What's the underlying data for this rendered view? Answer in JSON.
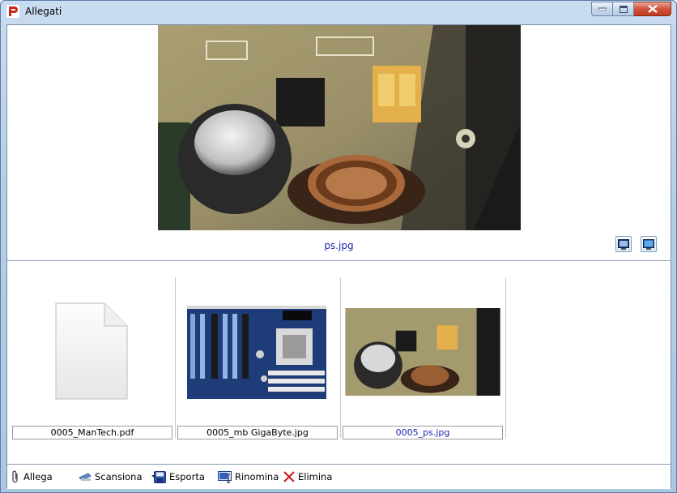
{
  "window": {
    "title": "Allegati"
  },
  "preview": {
    "filename": "ps.jpg"
  },
  "thumbnails": [
    {
      "caption": "0005_ManTech.pdf",
      "kind": "document-icon",
      "selected": false
    },
    {
      "caption": "0005_mb GigaByte.jpg",
      "kind": "motherboard-image",
      "selected": false
    },
    {
      "caption": "0005_ps.jpg",
      "kind": "power-supply-image",
      "selected": true
    }
  ],
  "toolbar": {
    "attach_label": "Allega",
    "scan_label": "Scansiona",
    "export_label": "Esporta",
    "rename_label": "Rinomina",
    "delete_label": "Elimina"
  },
  "colors": {
    "selected_text": "#1d24b0",
    "delete_red": "#cc1a1a"
  }
}
